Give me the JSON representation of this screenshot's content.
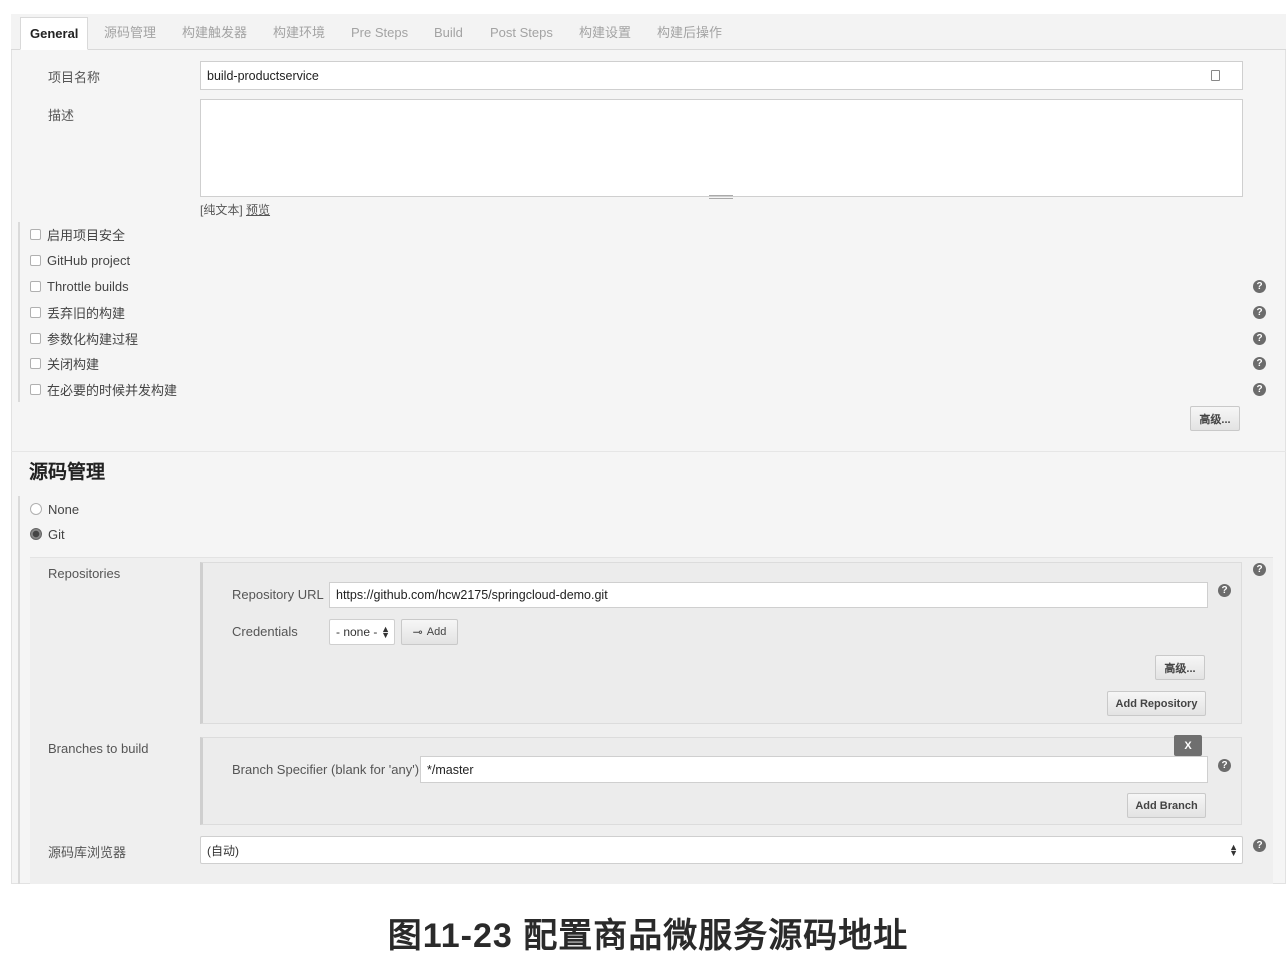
{
  "tabs": [
    {
      "label": "General",
      "active": true
    },
    {
      "label": "源码管理"
    },
    {
      "label": "构建触发器"
    },
    {
      "label": "构建环境"
    },
    {
      "label": "Pre Steps"
    },
    {
      "label": "Build"
    },
    {
      "label": "Post Steps"
    },
    {
      "label": "构建设置"
    },
    {
      "label": "构建后操作"
    }
  ],
  "general": {
    "project_name_label": "项目名称",
    "project_name_value": "build-productservice",
    "description_label": "描述",
    "description_value": "",
    "plain_text": "[纯文本]",
    "preview": "预览",
    "options": [
      {
        "label": "启用项目安全",
        "checked": false,
        "help": false
      },
      {
        "label": "GitHub project",
        "checked": false,
        "help": false
      },
      {
        "label": "Throttle builds",
        "checked": false,
        "help": true
      },
      {
        "label": "丢弃旧的构建",
        "checked": false,
        "help": true
      },
      {
        "label": "参数化构建过程",
        "checked": false,
        "help": true
      },
      {
        "label": "关闭构建",
        "checked": false,
        "help": true
      },
      {
        "label": "在必要的时候并发构建",
        "checked": false,
        "help": true
      }
    ],
    "advanced_button": "高级..."
  },
  "scm": {
    "title": "源码管理",
    "options": [
      {
        "label": "None",
        "selected": false
      },
      {
        "label": "Git",
        "selected": true
      }
    ],
    "repositories_label": "Repositories",
    "repository_url_label": "Repository URL",
    "repository_url_value": "https://github.com/hcw2175/springcloud-demo.git",
    "credentials_label": "Credentials",
    "credentials_value": "- none -",
    "add_button": "Add",
    "advanced_button": "高级...",
    "add_repository_button": "Add Repository",
    "branches_label": "Branches to build",
    "delete_button": "X",
    "branch_specifier_label": "Branch Specifier (blank for 'any')",
    "branch_specifier_value": "*/master",
    "add_branch_button": "Add Branch",
    "browser_label": "源码库浏览器",
    "browser_value": "(自动)"
  },
  "help_glyph": "?",
  "caption": "图11-23 配置商品微服务源码地址"
}
